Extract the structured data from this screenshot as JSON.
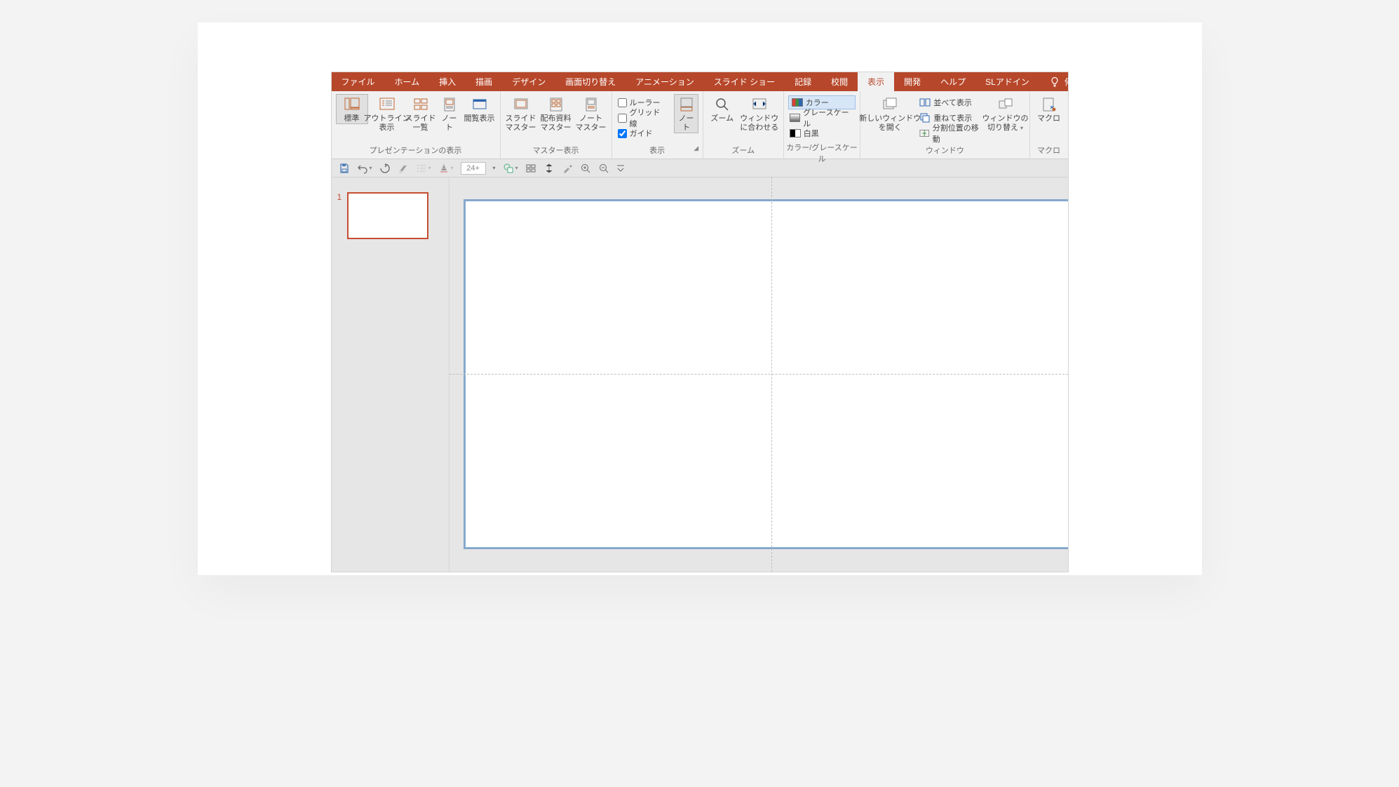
{
  "tabs": {
    "file": "ファイル",
    "home": "ホーム",
    "insert": "挿入",
    "draw": "描画",
    "design": "デザイン",
    "transitions": "画面切り替え",
    "animations": "アニメーション",
    "slideshow": "スライド ショー",
    "record": "記録",
    "review": "校閲",
    "view": "表示",
    "developer": "開発",
    "help": "ヘルプ",
    "sladdin": "SLアドイン",
    "tell_me": "何をしますか"
  },
  "groups": {
    "presentation_views": {
      "label": "プレゼンテーションの表示",
      "normal": "標準",
      "outline": "アウトライン\n表示",
      "sorter": "スライド\n一覧",
      "notes_page": "ノー\nト",
      "reading": "閲覧表示"
    },
    "master_views": {
      "label": "マスター表示",
      "slide_master": "スライド\nマスター",
      "handout_master": "配布資料\nマスター",
      "notes_master": "ノート\nマスター"
    },
    "show": {
      "label": "表示",
      "ruler": "ルーラー",
      "gridlines": "グリッド線",
      "guides": "ガイド"
    },
    "notes": {
      "label": "ノー\nト"
    },
    "zoom": {
      "label": "ズーム",
      "zoom": "ズーム",
      "fit": "ウィンドウ\nに合わせる"
    },
    "color_gray": {
      "label": "カラー/グレースケール",
      "color": "カラー",
      "grayscale": "グレースケール",
      "bw": "白黒"
    },
    "window": {
      "label": "ウィンドウ",
      "new_window": "新しいウィンドウ\nを開く",
      "arrange_all": "並べて表示",
      "cascade": "重ねて表示",
      "move_split": "分割位置の移動",
      "switch": "ウィンドウの\n切り替え"
    },
    "macros": {
      "label": "マクロ",
      "macros": "マクロ"
    }
  },
  "qat": {
    "font_size": "24+"
  },
  "slide": {
    "current_thumb_number": "1"
  },
  "colors": {
    "accent": "#b7472a",
    "slide_sel": "#86a9cd"
  },
  "checks": {
    "ruler": false,
    "gridlines": false,
    "guides": true
  }
}
